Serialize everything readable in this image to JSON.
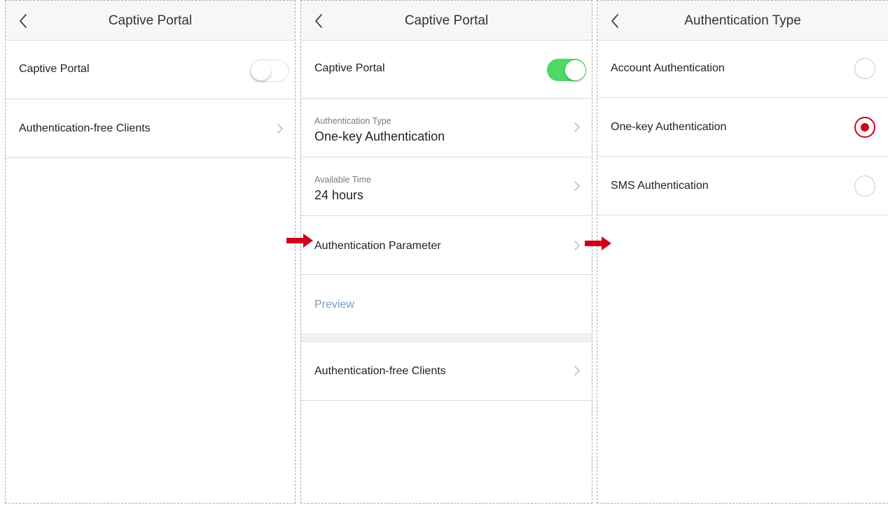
{
  "colors": {
    "toggle_on": "#4cd964",
    "radio_selected": "#d0021b",
    "preview_link": "#7a9cc0",
    "annotation_arrow": "#d0021b"
  },
  "screen1": {
    "title": "Captive Portal",
    "captive_portal_label": "Captive Portal",
    "captive_portal_enabled": false,
    "auth_free_clients_label": "Authentication-free Clients"
  },
  "screen2": {
    "title": "Captive Portal",
    "captive_portal_label": "Captive Portal",
    "captive_portal_enabled": true,
    "auth_type_caption": "Authentication Type",
    "auth_type_value": "One-key Authentication",
    "available_time_caption": "Available Time",
    "available_time_value": "24 hours",
    "auth_parameter_label": "Authentication Parameter",
    "preview_label": "Preview",
    "auth_free_clients_label": "Authentication-free Clients"
  },
  "screen3": {
    "title": "Authentication Type",
    "options": [
      {
        "label": "Account Authentication",
        "selected": false
      },
      {
        "label": "One-key Authentication",
        "selected": true
      },
      {
        "label": "SMS Authentication",
        "selected": false
      }
    ]
  },
  "icons": {
    "back": "chevron-left-icon",
    "row_chevron": "chevron-right-icon",
    "annotation": "red-arrow-icon"
  }
}
